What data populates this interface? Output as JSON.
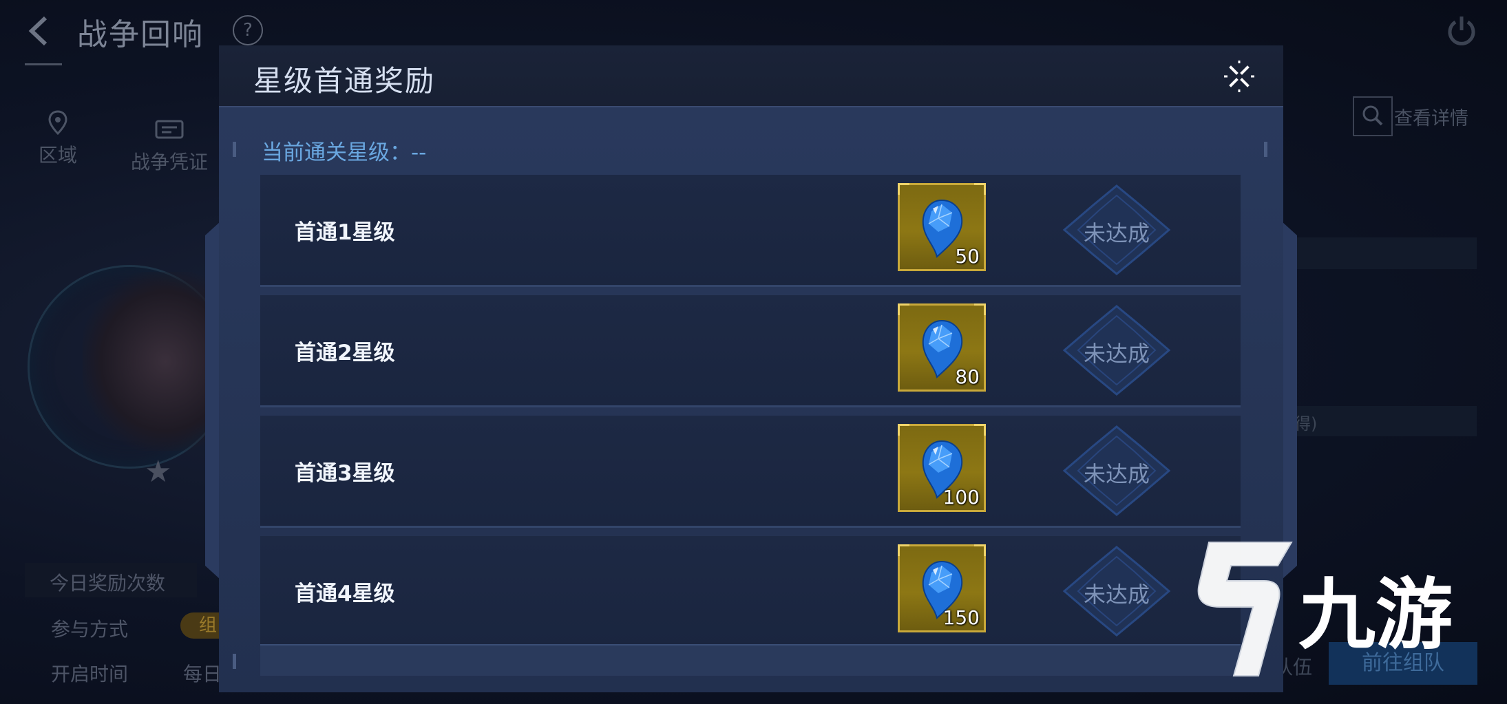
{
  "background_screen": {
    "title": "战争回响",
    "help_glyph": "?",
    "tabs": [
      {
        "label": "区域",
        "icon": "location-pin-icon"
      },
      {
        "label": "战争凭证",
        "icon": "ticket-icon"
      }
    ],
    "search_label": "查看详情",
    "rows": [
      {
        "label": "今日奖励次数"
      },
      {
        "label": "参与方式",
        "pill": "组"
      },
      {
        "label": "开启时间",
        "value": "每日"
      }
    ],
    "right_fragment": "得)",
    "go_button": "前往组队",
    "go_prefix": "队伍"
  },
  "modal": {
    "title": "星级首通奖励",
    "status_label": "当前通关星级：",
    "status_value": "--",
    "rewards": [
      {
        "label": "首通1星级",
        "item": "blue-gem-icon",
        "quantity": "50",
        "status": "未达成"
      },
      {
        "label": "首通2星级",
        "item": "blue-gem-icon",
        "quantity": "80",
        "status": "未达成"
      },
      {
        "label": "首通3星级",
        "item": "blue-gem-icon",
        "quantity": "100",
        "status": "未达成"
      },
      {
        "label": "首通4星级",
        "item": "blue-gem-icon",
        "quantity": "150",
        "status": "未达成"
      }
    ]
  },
  "watermark": {
    "text": "九游"
  },
  "colors": {
    "accent_blue": "#6aa7e0",
    "slot_gold": "#8d7714",
    "modal_bg": "#263556"
  }
}
